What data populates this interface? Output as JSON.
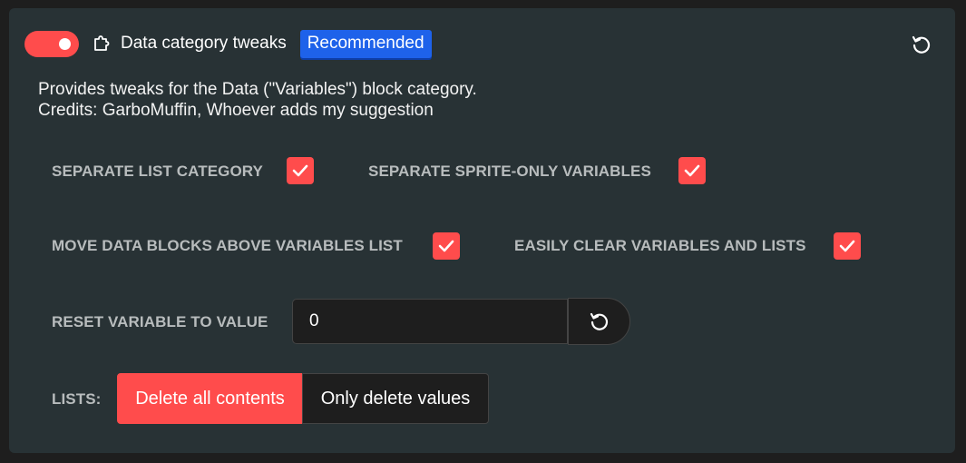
{
  "addon": {
    "title": "Data category tweaks",
    "badge": "Recommended",
    "description_line1": "Provides tweaks for the Data (\"Variables\") block category.",
    "description_line2": "Credits: GarboMuffin, Whoever adds my suggestion",
    "enabled": true
  },
  "settings": {
    "separate_list_category": {
      "label": "SEPARATE LIST CATEGORY",
      "checked": true
    },
    "separate_sprite_only": {
      "label": "SEPARATE SPRITE-ONLY VARIABLES",
      "checked": true
    },
    "move_data_blocks": {
      "label": "MOVE DATA BLOCKS ABOVE VARIABLES LIST",
      "checked": true
    },
    "easily_clear": {
      "label": "EASILY CLEAR VARIABLES AND LISTS",
      "checked": true
    },
    "reset_value": {
      "label": "RESET VARIABLE TO VALUE",
      "value": "0"
    },
    "lists": {
      "label": "LISTS:",
      "options": [
        "Delete all contents",
        "Only delete values"
      ],
      "selected": "Delete all contents"
    }
  },
  "icons": {
    "toggle": "toggle-switch-icon",
    "addon": "puzzle-piece-icon",
    "reset": "reset-icon",
    "check": "checkmark-icon"
  },
  "colors": {
    "accent": "#ff4c4c",
    "badge": "#1e62ea",
    "card": "#283235",
    "background": "#1e1e1e"
  }
}
